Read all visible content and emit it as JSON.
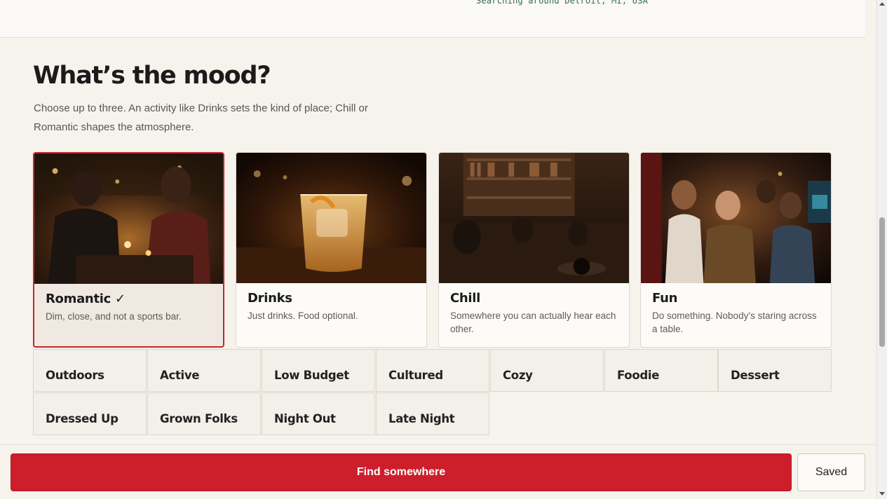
{
  "header": {
    "search_location": "Searching around Detroit, MI, USA"
  },
  "mood": {
    "title": "What’s the mood?",
    "subtitle": "Choose up to three. An activity like Drinks sets the kind of place; Chill or Romantic shapes the atmosphere.",
    "cards": [
      {
        "name": "Romantic ✓",
        "description": "Dim, close, and not a sports bar.",
        "selected": true,
        "image": "romantic-dinner-image"
      },
      {
        "name": "Drinks",
        "description": "Just drinks. Food optional.",
        "selected": false,
        "image": "cocktail-glass-image"
      },
      {
        "name": "Chill",
        "description": "Somewhere you can actually hear each other.",
        "selected": false,
        "image": "record-lounge-image"
      },
      {
        "name": "Fun",
        "description": "Do something. Nobody’s staring across a table.",
        "selected": false,
        "image": "arcade-friends-image"
      }
    ],
    "tags": [
      "Outdoors",
      "Active",
      "Low Budget",
      "Cultured",
      "Cozy",
      "Foodie",
      "Dessert",
      "Dressed Up",
      "Grown Folks",
      "Night Out",
      "Late Night"
    ]
  },
  "footer": {
    "find_label": "Find somewhere",
    "saved_label": "Saved"
  },
  "colors": {
    "accent": "#cc1f2b",
    "background": "#f6f2ec",
    "location_text": "#2f6b4e"
  }
}
